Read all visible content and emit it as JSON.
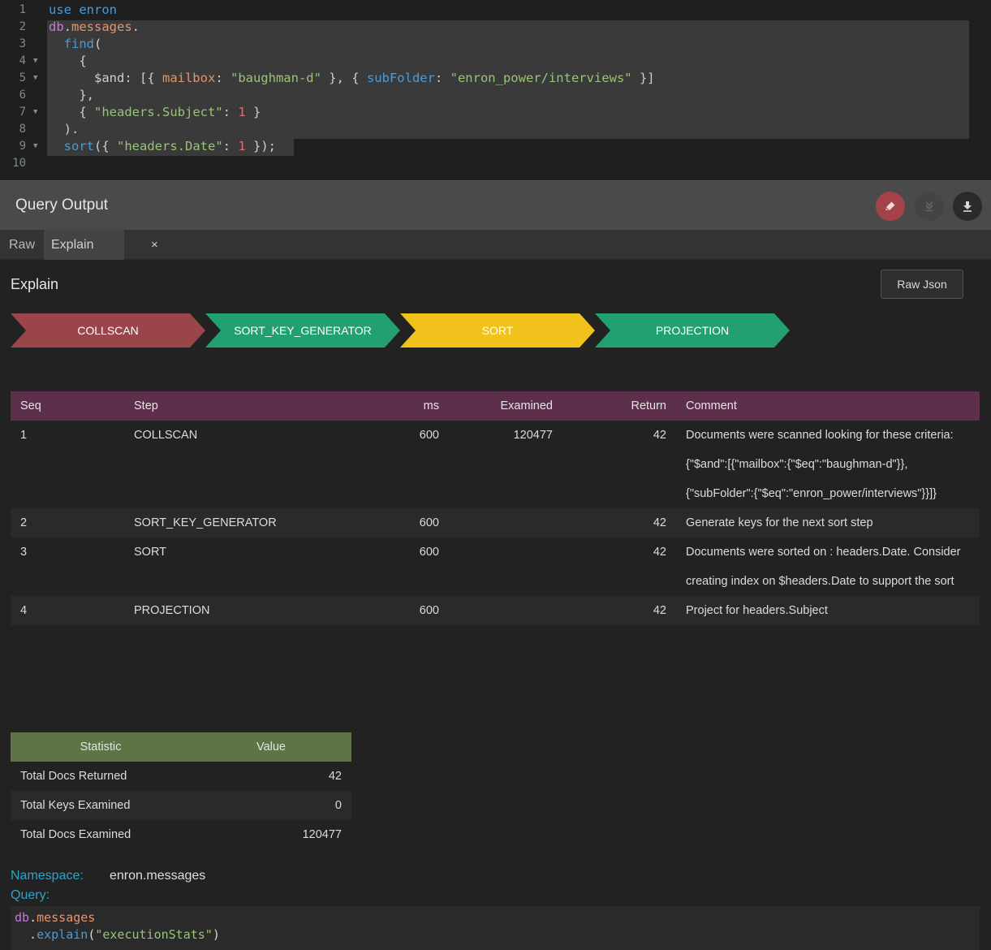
{
  "editor": {
    "lines": [
      {
        "num": "1",
        "fold": "",
        "segments": [
          {
            "t": "use enron",
            "c": "k-blue"
          }
        ]
      },
      {
        "num": "2",
        "fold": "",
        "segments": [
          {
            "t": "db",
            "c": "k-purple"
          },
          {
            "t": ".",
            "c": ""
          },
          {
            "t": "messages",
            "c": "k-orange"
          },
          {
            "t": ".",
            "c": ""
          }
        ]
      },
      {
        "num": "3",
        "fold": "",
        "segments": [
          {
            "t": "  find",
            "c": "k-blue"
          },
          {
            "t": "(",
            "c": ""
          }
        ]
      },
      {
        "num": "4",
        "fold": "▼",
        "segments": [
          {
            "t": "    {",
            "c": ""
          }
        ]
      },
      {
        "num": "5",
        "fold": "▼",
        "segments": [
          {
            "t": "      $and: [{ ",
            "c": ""
          },
          {
            "t": "mailbox",
            "c": "k-orange"
          },
          {
            "t": ": ",
            "c": ""
          },
          {
            "t": "\"baughman-d\"",
            "c": "k-str"
          },
          {
            "t": " }, { ",
            "c": ""
          },
          {
            "t": "subFolder",
            "c": "k-blue"
          },
          {
            "t": ": ",
            "c": ""
          },
          {
            "t": "\"enron_power/interviews\"",
            "c": "k-str"
          },
          {
            "t": " }]",
            "c": ""
          }
        ]
      },
      {
        "num": "6",
        "fold": "",
        "segments": [
          {
            "t": "    },",
            "c": ""
          }
        ]
      },
      {
        "num": "7",
        "fold": "▼",
        "segments": [
          {
            "t": "    { ",
            "c": ""
          },
          {
            "t": "\"headers.Subject\"",
            "c": "k-str"
          },
          {
            "t": ": ",
            "c": ""
          },
          {
            "t": "1",
            "c": "k-num"
          },
          {
            "t": " }",
            "c": ""
          }
        ]
      },
      {
        "num": "8",
        "fold": "",
        "segments": [
          {
            "t": "  ).",
            "c": ""
          }
        ]
      },
      {
        "num": "9",
        "fold": "▼",
        "segments": [
          {
            "t": "  sort",
            "c": "k-blue"
          },
          {
            "t": "({ ",
            "c": ""
          },
          {
            "t": "\"headers.Date\"",
            "c": "k-str"
          },
          {
            "t": ": ",
            "c": ""
          },
          {
            "t": "1",
            "c": "k-num"
          },
          {
            "t": " });",
            "c": ""
          }
        ]
      },
      {
        "num": "10",
        "fold": "",
        "segments": []
      }
    ]
  },
  "output": {
    "title": "Query Output",
    "buttons": {
      "clear": "eraser-icon",
      "collapse": "collapse-icon",
      "download": "download-icon"
    }
  },
  "tabs": {
    "raw": "Raw",
    "explain": "Explain",
    "close": "×"
  },
  "explain": {
    "heading": "Explain",
    "raw_json_button": "Raw Json",
    "stages": [
      "COLLSCAN",
      "SORT_KEY_GENERATOR",
      "SORT",
      "PROJECTION"
    ],
    "stage_colors": [
      "#994549",
      "#23a06f",
      "#f0c21b",
      "#23a06f"
    ],
    "steps_header": {
      "seq": "Seq",
      "step": "Step",
      "ms": "ms",
      "examined": "Examined",
      "return": "Return",
      "comment": "Comment"
    },
    "steps": [
      {
        "seq": "1",
        "step": "COLLSCAN",
        "ms": "600",
        "examined": "120477",
        "return": "42",
        "comment": "Documents were scanned looking for these criteria: {\"$and\":[{\"mailbox\":{\"$eq\":\"baughman-d\"}},{\"subFolder\":{\"$eq\":\"enron_power/interviews\"}}]}"
      },
      {
        "seq": "2",
        "step": "SORT_KEY_GENERATOR",
        "ms": "600",
        "examined": "",
        "return": "42",
        "comment": "Generate keys for the next sort step"
      },
      {
        "seq": "3",
        "step": "SORT",
        "ms": "600",
        "examined": "",
        "return": "42",
        "comment": "Documents were sorted on : headers.Date. Consider creating index on $headers.Date to support the sort"
      },
      {
        "seq": "4",
        "step": "PROJECTION",
        "ms": "600",
        "examined": "",
        "return": "42",
        "comment": "Project for headers.Subject"
      }
    ],
    "stats_header": {
      "statistic": "Statistic",
      "value": "Value"
    },
    "stats": [
      {
        "name": "Total Docs Returned",
        "value": "42"
      },
      {
        "name": "Total Keys Examined",
        "value": "0"
      },
      {
        "name": "Total Docs Examined",
        "value": "120477"
      }
    ],
    "namespace_label": "Namespace:",
    "namespace_value": "enron.messages",
    "query_label": "Query:",
    "query_lines": [
      [
        {
          "t": "db",
          "c": "k-purple"
        },
        {
          "t": ".",
          "c": ""
        },
        {
          "t": "messages",
          "c": "k-orange"
        }
      ],
      [
        {
          "t": "  .",
          "c": ""
        },
        {
          "t": "explain",
          "c": "k-blue"
        },
        {
          "t": "(",
          "c": ""
        },
        {
          "t": "\"executionStats\"",
          "c": "k-str"
        },
        {
          "t": ")",
          "c": ""
        }
      ]
    ]
  }
}
